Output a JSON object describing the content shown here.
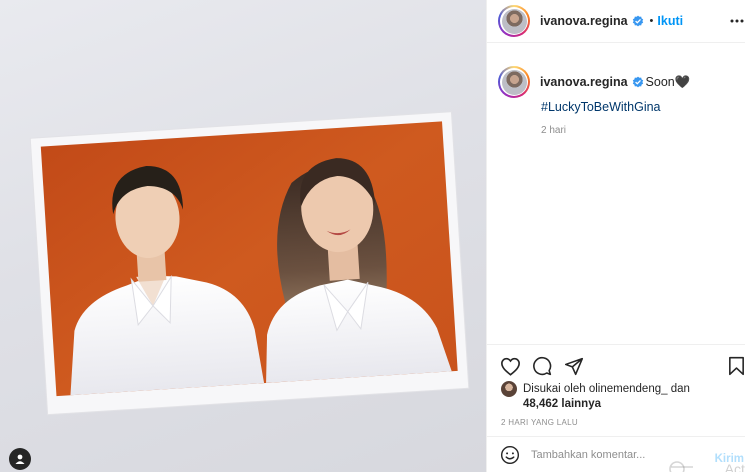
{
  "post": {
    "username": "ivanova.regina",
    "separator": "•",
    "follow_label": "Ikuti",
    "more_icon": "more-horizontal-icon",
    "verified_icon": "verified-badge-icon"
  },
  "caption": {
    "username": "ivanova.regina",
    "text": "Soon🖤",
    "hashtag": "#LuckyToBeWithGina",
    "time": "2 hari"
  },
  "actions": {
    "like_icon": "heart-icon",
    "comment_icon": "comment-icon",
    "share_icon": "send-icon",
    "save_icon": "bookmark-icon"
  },
  "likes": {
    "prefix": "Disukai oleh",
    "liker": "olinemendeng_",
    "connector": "dan",
    "count": "48,462 lainnya"
  },
  "post_date": "2 HARI YANG LALU",
  "comment": {
    "placeholder": "Tambahkan komentar...",
    "send_label": "Kirim",
    "emoji_icon": "smiley-icon"
  },
  "overlay": {
    "watermark_text": "Acti"
  },
  "media": {
    "tag_icon": "user-tag-icon"
  },
  "colors": {
    "accent": "#0095f6",
    "hashtag": "#00376b",
    "muted": "#8e8e8e",
    "photo_background": "#c9511a"
  }
}
